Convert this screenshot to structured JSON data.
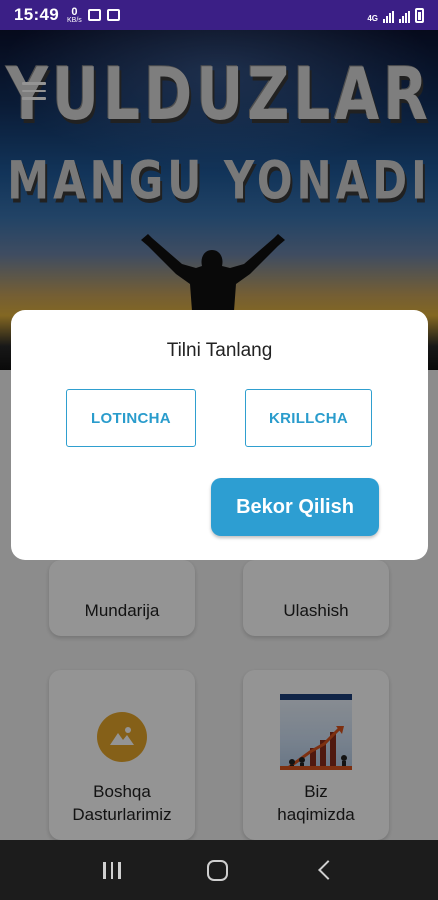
{
  "status_bar": {
    "time": "15:49",
    "data_speed_value": "0",
    "data_speed_unit": "KB/s",
    "network_type": "4G",
    "icons": [
      "data-speed-icon",
      "gallery-icon",
      "message-icon",
      "signal-icon",
      "battery-icon"
    ]
  },
  "hero": {
    "title": "YULDUZLAR",
    "subtitle": "MANGU YONADI",
    "menu_icon": "hamburger-menu-icon"
  },
  "cards": [
    {
      "label": "Mundarija"
    },
    {
      "label": "Ulashish"
    },
    {
      "label": "Boshqa\nDasturlarimiz",
      "icon": "landscape-icon"
    },
    {
      "label": "Biz\nhaqimizda",
      "icon": "team-growth-image"
    }
  ],
  "dialog": {
    "title": "Tilni Tanlang",
    "options": [
      "LOTINCHA",
      "KRILLCHA"
    ],
    "cancel_label": "Bekor Qilish"
  },
  "navbar": {
    "icons": [
      "recent-apps-icon",
      "home-icon",
      "back-icon"
    ]
  },
  "colors": {
    "status_bar": "#3b1f86",
    "accent": "#2d9ed2",
    "card_icon": "#e6a62a"
  }
}
